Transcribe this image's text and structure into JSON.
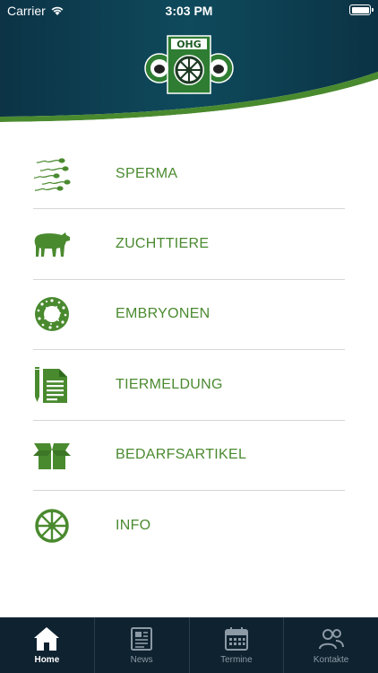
{
  "status_bar": {
    "carrier": "Carrier",
    "time": "3:03 PM"
  },
  "logo": {
    "text": "OHG"
  },
  "colors": {
    "accent": "#4a8a2f",
    "header_dark": "#0b2a3c",
    "tabbar": "#0f2230"
  },
  "menu": {
    "items": [
      {
        "label": "SPERMA",
        "icon": "sperm-icon"
      },
      {
        "label": "ZUCHTTIERE",
        "icon": "cow-icon"
      },
      {
        "label": "EMBRYONEN",
        "icon": "embryo-icon"
      },
      {
        "label": "TIERMELDUNG",
        "icon": "document-icon"
      },
      {
        "label": "BEDARFSARTIKEL",
        "icon": "box-icon"
      },
      {
        "label": "INFO",
        "icon": "wheel-icon"
      }
    ]
  },
  "tabs": [
    {
      "label": "Home",
      "icon": "home-icon",
      "active": true
    },
    {
      "label": "News",
      "icon": "newspaper-icon",
      "active": false
    },
    {
      "label": "Termine",
      "icon": "calendar-icon",
      "active": false
    },
    {
      "label": "Kontakte",
      "icon": "contacts-icon",
      "active": false
    }
  ]
}
